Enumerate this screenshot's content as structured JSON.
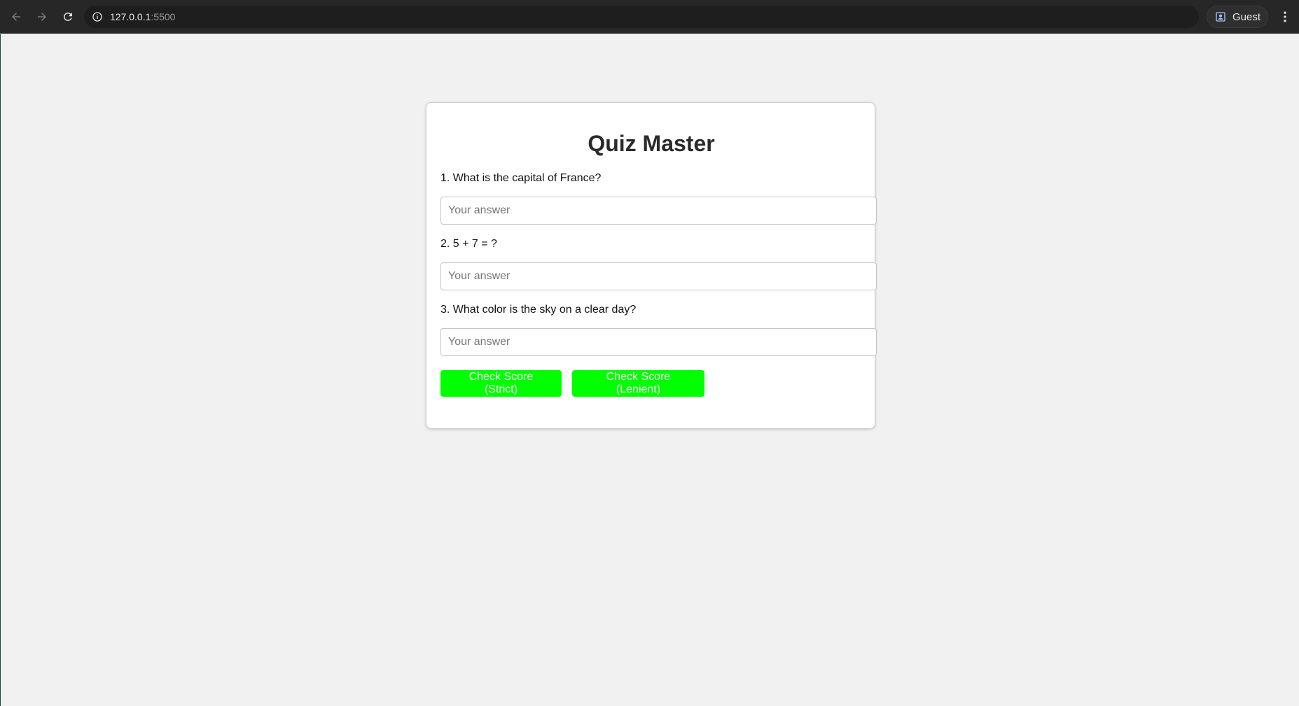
{
  "browser": {
    "url_host": "127.0.0.1",
    "url_port": ":5500",
    "profile_label": "Guest"
  },
  "quiz": {
    "title": "Quiz Master",
    "questions": [
      {
        "label": "1. What is the capital of France?",
        "placeholder": "Your answer",
        "value": ""
      },
      {
        "label": "2. 5 + 7 = ?",
        "placeholder": "Your answer",
        "value": ""
      },
      {
        "label": "3. What color is the sky on a clear day?",
        "placeholder": "Your answer",
        "value": ""
      }
    ],
    "buttons": {
      "strict_label": "Check Score (Strict)",
      "lenient_label": "Check Score (Lenient)"
    }
  },
  "colors": {
    "button_bg": "#00ff00",
    "button_text": "#ffffff",
    "page_bg": "#f1f1f1",
    "chrome_bg": "#272727"
  },
  "icons": {
    "back": "back-arrow-icon",
    "forward": "forward-arrow-icon",
    "reload": "reload-icon",
    "info": "info-icon",
    "profile": "profile-icon",
    "menu": "kebab-menu-icon"
  }
}
